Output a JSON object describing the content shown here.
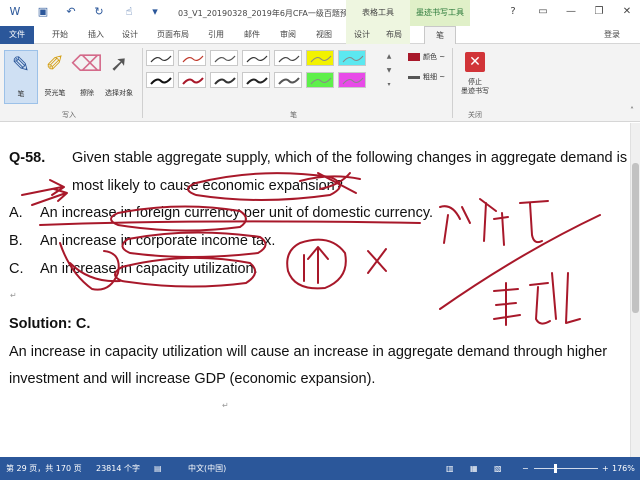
{
  "window": {
    "title": "03_V1_20190328_2019年6月CFA一级百题预...",
    "context_tab_group_1": "表格工具",
    "context_tab_group_2": "墨迹书写工具"
  },
  "tabs": {
    "file": "文件",
    "items": [
      "开始",
      "插入",
      "设计",
      "页面布局",
      "引用",
      "邮件",
      "审阅",
      "视图",
      "设计",
      "布局",
      "笔"
    ],
    "login": "登录"
  },
  "ribbon": {
    "tools": {
      "pen": "笔",
      "highlighter": "荧光笔",
      "eraser": "擦除",
      "select": "选择对象"
    },
    "group_write": "写入",
    "group_pens": "笔",
    "group_close": "关闭",
    "color_label": "颜色 ~",
    "thickness_label": "粗细 ~",
    "stop_label_1": "停止",
    "stop_label_2": "墨迹书写",
    "colors": {
      "accent": "#2b579a",
      "ink_red": "#a8182a",
      "highlight_yellow": "#f2f200",
      "highlight_cyan": "#5ce8f0",
      "highlight_green": "#5ef04a",
      "highlight_magenta": "#e84ae8",
      "stop_red": "#d13438"
    }
  },
  "document": {
    "question_number": "Q-58.",
    "question_line1": "Given stable aggregate supply, which of the following changes in aggregate demand is",
    "question_line2": "most likely to cause economic expansion?",
    "options": [
      {
        "letter": "A.",
        "text": "An increase in foreign currency per unit of domestic currency."
      },
      {
        "letter": "B.",
        "text": "An increase in corporate income tax."
      },
      {
        "letter": "C.",
        "text": "An increase in capacity utilization."
      }
    ],
    "solution_label": "Solution: C.",
    "solution_line1": "An increase in capacity utilization will cause an increase in aggregate demand through higher",
    "solution_line2": "investment and will increase GDP (economic expansion)."
  },
  "status": {
    "page": "第 29 页，共 170 页",
    "words": "23814 个字",
    "language": "中文(中国)",
    "zoom": "176%",
    "zoom_minus": "−",
    "zoom_plus": "+"
  }
}
